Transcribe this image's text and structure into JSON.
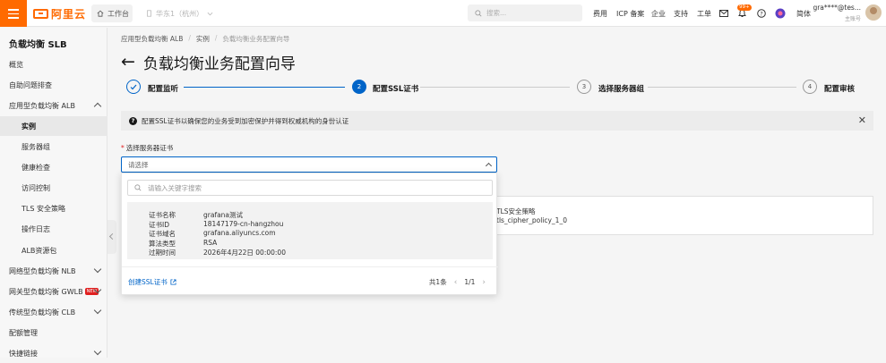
{
  "topbar": {
    "logo_text": "阿里云",
    "workbench": "工作台",
    "region": "华东1（杭州）",
    "search_placeholder": "搜索...",
    "nav": [
      "费用",
      "ICP 备案",
      "企业",
      "支持",
      "工单"
    ],
    "notification_badge": "99+",
    "language": "简体",
    "user_name": "gra****@tes...",
    "user_role": "主账号"
  },
  "sidebar": {
    "title": "负载均衡 SLB",
    "items": [
      {
        "label": "概览"
      },
      {
        "label": "自助问题排查"
      },
      {
        "label": "应用型负载均衡 ALB"
      },
      {
        "label": "实例"
      },
      {
        "label": "服务器组"
      },
      {
        "label": "健康检查"
      },
      {
        "label": "访问控制"
      },
      {
        "label": "TLS 安全策略"
      },
      {
        "label": "操作日志"
      },
      {
        "label": "ALB资源包"
      },
      {
        "label": "网络型负载均衡 NLB"
      },
      {
        "label": "网关型负载均衡 GWLB",
        "tag": "NEW"
      },
      {
        "label": "传统型负载均衡 CLB"
      },
      {
        "label": "配额管理"
      },
      {
        "label": "快捷链接"
      }
    ]
  },
  "breadcrumb": [
    "应用型负载均衡 ALB",
    "实例",
    "负载均衡业务配置向导"
  ],
  "page": {
    "title": "负载均衡业务配置向导"
  },
  "steps": [
    {
      "num": "",
      "label": "配置监听",
      "state": "done"
    },
    {
      "num": "2",
      "label": "配置SSL证书",
      "state": "active"
    },
    {
      "num": "3",
      "label": "选择服务器组",
      "state": "pending"
    },
    {
      "num": "4",
      "label": "配置审核",
      "state": "pending"
    }
  ],
  "alert": {
    "text": "配置SSL证书以确保您的业务受到加密保护并得到权威机构的身份认证"
  },
  "form": {
    "cert_label": "选择服务器证书",
    "cert_placeholder": "请选择"
  },
  "background_panel": {
    "col_label": "TLS安全策略",
    "col_value": "tls_cipher_policy_1_0"
  },
  "dropdown": {
    "search_placeholder": "请输入关键字搜索",
    "option": [
      {
        "key": "证书名称",
        "value": "grafana测试"
      },
      {
        "key": "证书ID",
        "value": "18147179-cn-hangzhou"
      },
      {
        "key": "证书域名",
        "value": "grafana.aliyuncs.com"
      },
      {
        "key": "算法类型",
        "value": "RSA"
      },
      {
        "key": "过期时间",
        "value": "2026年4月22日 00:00:00"
      }
    ],
    "create_link": "创建SSL证书",
    "total": "共1条",
    "page": "1/1"
  },
  "colors": {
    "brand_orange": "#ff6a00",
    "primary_blue": "#0064c8"
  }
}
